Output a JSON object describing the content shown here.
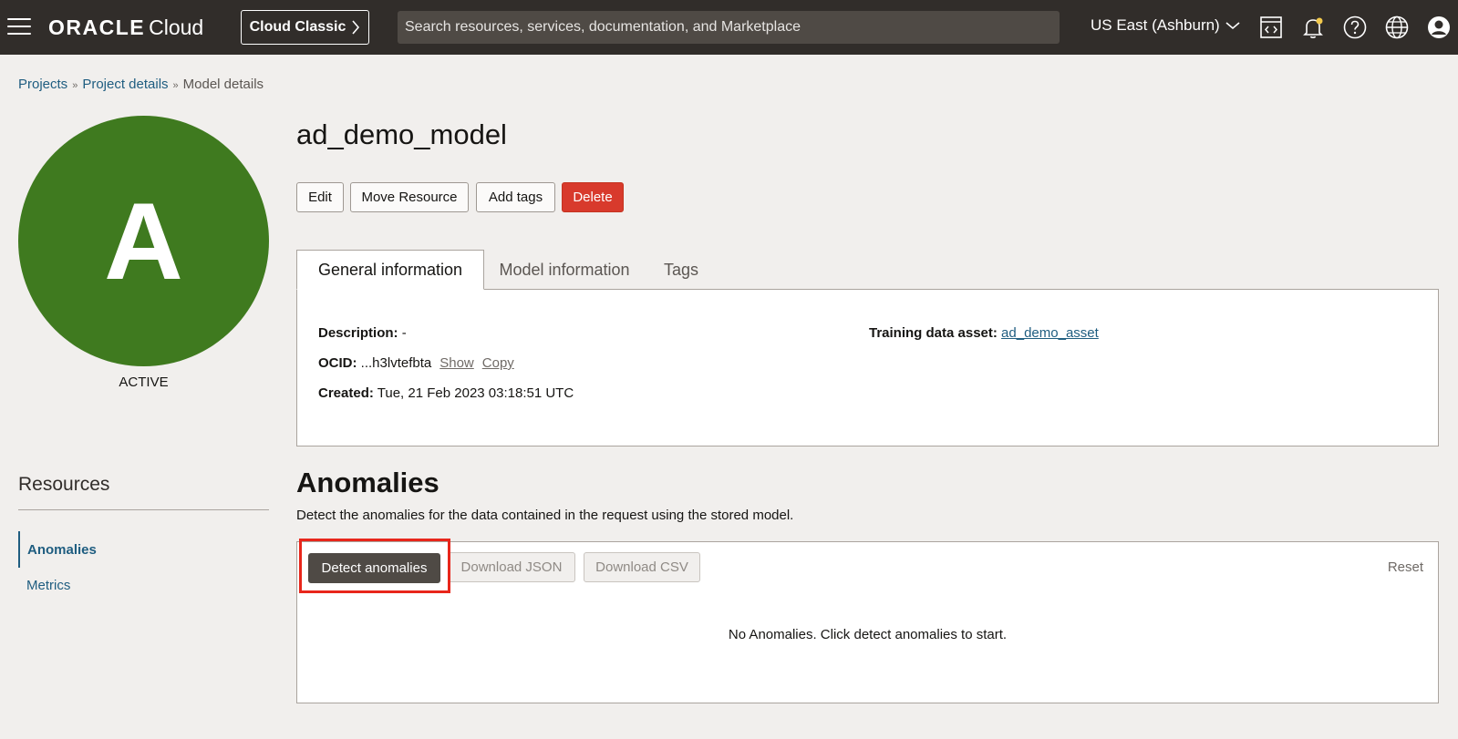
{
  "topbar": {
    "brand_primary": "ORACLE",
    "brand_secondary": "Cloud",
    "classic_label": "Cloud Classic",
    "search_placeholder": "Search resources, services, documentation, and Marketplace",
    "region": "US East (Ashburn)",
    "icons": [
      "menu-icon",
      "chevron-right-icon",
      "chevron-down-icon",
      "code-editor-icon",
      "bell-icon",
      "help-icon",
      "globe-icon",
      "user-icon"
    ]
  },
  "breadcrumb": {
    "items": [
      "Projects",
      "Project details"
    ],
    "current": "Model details",
    "separator": "»"
  },
  "avatar": {
    "letter": "A",
    "status": "ACTIVE",
    "color": "#3f7a1f"
  },
  "resources": {
    "title": "Resources",
    "items": [
      "Anomalies",
      "Metrics"
    ]
  },
  "model": {
    "name": "ad_demo_model",
    "actions": {
      "edit": "Edit",
      "move": "Move Resource",
      "tags": "Add tags",
      "delete": "Delete"
    }
  },
  "tabs": [
    "General information",
    "Model information",
    "Tags"
  ],
  "general": {
    "description_label": "Description:",
    "description_value": "-",
    "ocid_label": "OCID:",
    "ocid_value": "...h3lvtefbta",
    "show": "Show",
    "copy": "Copy",
    "created_label": "Created:",
    "created_value": "Tue, 21 Feb 2023 03:18:51 UTC",
    "training_label": "Training data asset:",
    "training_value": "ad_demo_asset"
  },
  "anomalies": {
    "title": "Anomalies",
    "description": "Detect the anomalies for the data contained in the request using the stored model.",
    "detect": "Detect anomalies",
    "download_json": "Download JSON",
    "download_csv": "Download CSV",
    "reset": "Reset",
    "empty": "No Anomalies. Click detect anomalies to start."
  },
  "colors": {
    "topbar": "#312d2a",
    "link": "#1f5d80",
    "danger": "#d83a2c",
    "highlight": "#e8261b"
  }
}
